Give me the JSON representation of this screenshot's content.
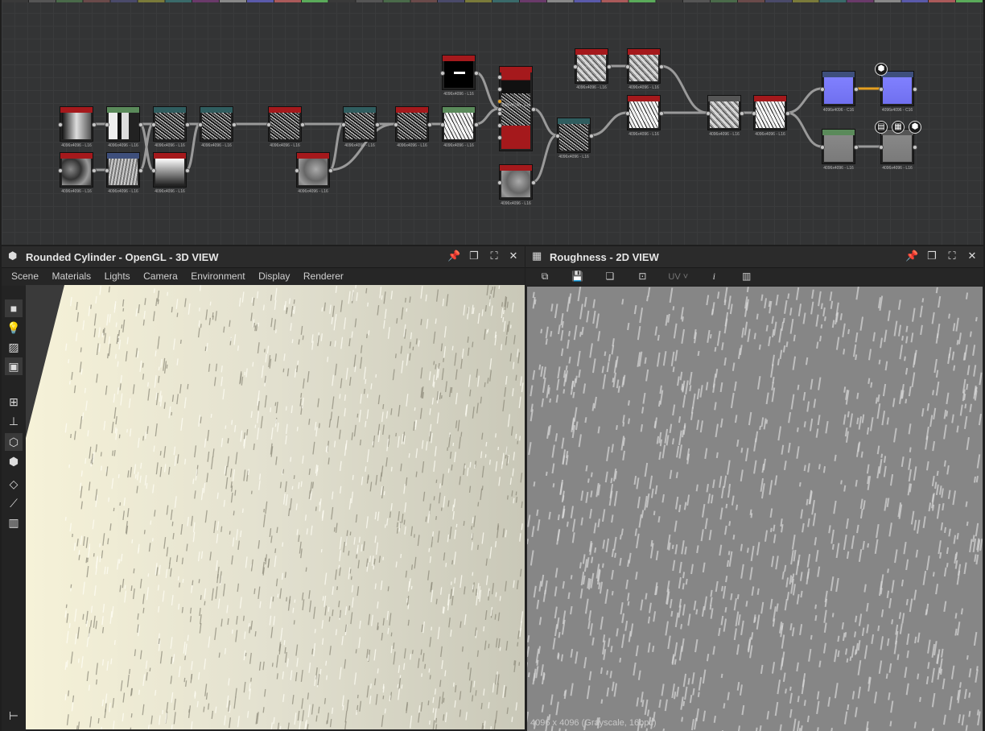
{
  "colors": {
    "node_red": "#a5191c",
    "node_teal": "#2f5d5f",
    "node_green": "#5a8a5a",
    "node_blue": "#3e4f7c",
    "wire": "#9a9a9a",
    "wire_active": "#e6a020",
    "normal_purple": "#7b7bf0"
  },
  "graph": {
    "nodes": [
      {
        "id": "n1",
        "label": "4096x4096 - L16",
        "header": "red",
        "thumb": "gradient-h"
      },
      {
        "id": "n2",
        "label": "4096x4096 - L16",
        "header": "green",
        "thumb": "bands"
      },
      {
        "id": "n3",
        "label": "4096x4096 - L16",
        "header": "teal",
        "thumb": "noise-dark"
      },
      {
        "id": "n4",
        "label": "4096x4096 - L16",
        "header": "teal",
        "thumb": "noise-dark"
      },
      {
        "id": "n5",
        "label": "4096x4096 - L16",
        "header": "red",
        "thumb": "noise-dark"
      },
      {
        "id": "n6",
        "label": "4096x4096 - L16",
        "header": "red",
        "thumb": "clouds"
      },
      {
        "id": "n7",
        "label": "4096x4096 - L16",
        "header": "blue",
        "thumb": "waves"
      },
      {
        "id": "n8",
        "label": "4096x4096 - L16",
        "header": "red",
        "thumb": "gradient-v"
      },
      {
        "id": "n9",
        "label": "4096x4096 - L16",
        "header": "red",
        "thumb": "clouds-gray"
      },
      {
        "id": "n10",
        "label": "4096x4096 - L16",
        "header": "teal",
        "thumb": "noise-dark"
      },
      {
        "id": "n11",
        "label": "4096x4096 - L16",
        "header": "red",
        "thumb": "noise-dark"
      },
      {
        "id": "n12",
        "label": "4096x4096 - L16",
        "header": "green",
        "thumb": "noise-light"
      },
      {
        "id": "n13",
        "label": "4096x4096 - L16",
        "header": "red",
        "thumb": "shape"
      },
      {
        "id": "n14",
        "label": "4096x4096 - L16",
        "header": "red",
        "thumb": "blend"
      },
      {
        "id": "n15",
        "label": "4096x4096 - L16",
        "header": "red",
        "thumb": "clouds-gray"
      },
      {
        "id": "n16",
        "label": "4096x4096 - L16",
        "header": "teal",
        "thumb": "noise-dark"
      },
      {
        "id": "n17",
        "label": "4096x4096 - L16",
        "header": "red",
        "thumb": "noise-mid"
      },
      {
        "id": "n18",
        "label": "4096x4096 - L16",
        "header": "red",
        "thumb": "noise-mid"
      },
      {
        "id": "n19",
        "label": "4096x4096 - L16",
        "header": "red",
        "thumb": "noise-light"
      },
      {
        "id": "n20",
        "label": "4096x4096 - L16",
        "header": "gray",
        "thumb": "noise-mid"
      },
      {
        "id": "n21",
        "label": "4096x4096 - L16",
        "header": "red",
        "thumb": "noise-light"
      },
      {
        "id": "n22",
        "label": "4096x4096 - C16",
        "header": "blue",
        "thumb": "normal"
      },
      {
        "id": "n23",
        "label": "4096x4096 - C16",
        "header": "blue",
        "thumb": "normal"
      },
      {
        "id": "n24",
        "label": "4096x4096 - L16",
        "header": "green",
        "thumb": "flat-gray"
      },
      {
        "id": "n25",
        "label": "4096x4096 - L16",
        "header": "gray",
        "thumb": "flat-gray"
      }
    ]
  },
  "view3d": {
    "title": "Rounded Cylinder - OpenGL - 3D VIEW",
    "menu": [
      "Scene",
      "Materials",
      "Lights",
      "Camera",
      "Environment",
      "Display",
      "Renderer"
    ],
    "tools": [
      "camera-icon",
      "light-bulb-icon",
      "environment-map-icon",
      "screenshot-icon",
      "grid-icon",
      "axis-icon",
      "cube-icon",
      "cube-wire-icon",
      "plane-icon",
      "gizmo-icon",
      "histogram-icon"
    ]
  },
  "view2d": {
    "title": "Roughness - 2D VIEW",
    "uv_label": "UV",
    "status": "4096 x 4096 (Grayscale, 16bpc)"
  }
}
